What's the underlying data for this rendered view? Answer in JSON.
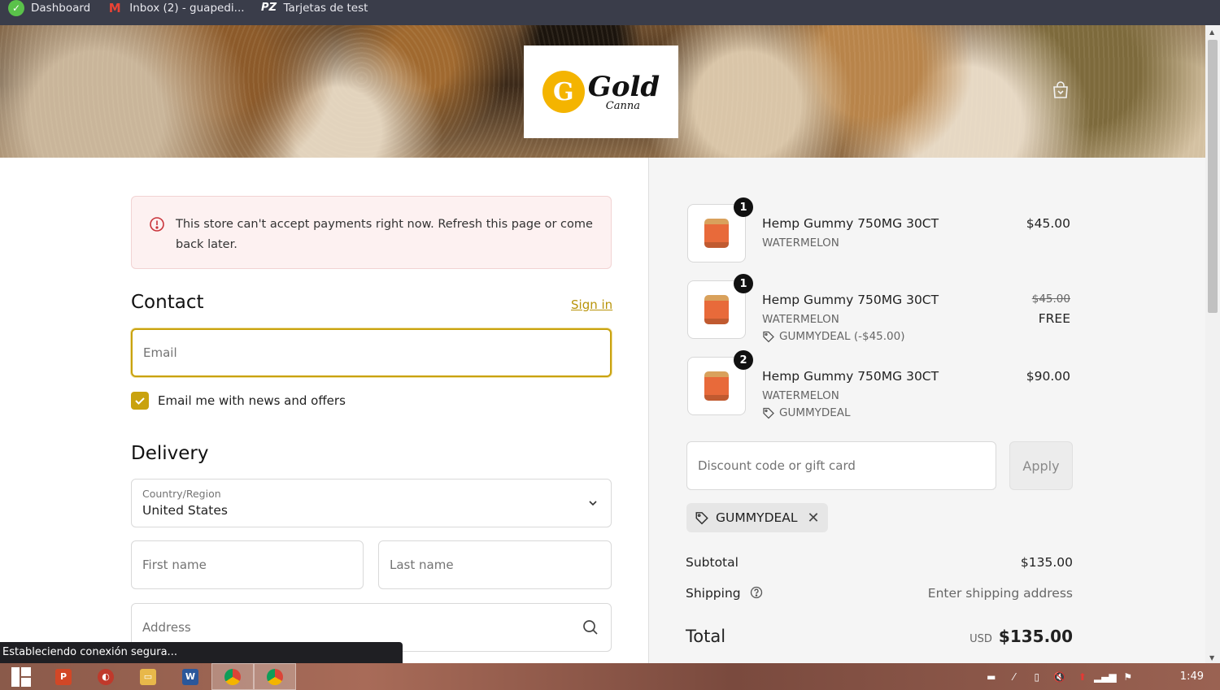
{
  "bookmarks": [
    {
      "label": "Dashboard",
      "icon": "dashboard-icon"
    },
    {
      "label": "Inbox (2) - guapedi...",
      "icon": "gmail-icon"
    },
    {
      "label": "Tarjetas de test",
      "icon": "pz-icon"
    }
  ],
  "store": {
    "logo_main": "Gold",
    "logo_sub": "Canna"
  },
  "alert": {
    "text": "This store can't accept payments right now. Refresh this page or come back later."
  },
  "contact": {
    "heading": "Contact",
    "sign_in": "Sign in",
    "email_placeholder": "Email",
    "newsletter_label": "Email me with news and offers",
    "newsletter_checked": true
  },
  "delivery": {
    "heading": "Delivery",
    "country_label": "Country/Region",
    "country_value": "United States",
    "first_name_placeholder": "First name",
    "last_name_placeholder": "Last name",
    "address_placeholder": "Address"
  },
  "status_bar": "Estableciendo conexión segura...",
  "cart": {
    "items": [
      {
        "qty": "1",
        "name": "Hemp Gummy 750MG 30CT",
        "variant": "WATERMELON",
        "price": "$45.00"
      },
      {
        "qty": "1",
        "name": "Hemp Gummy 750MG 30CT",
        "variant": "WATERMELON",
        "old_price": "$45.00",
        "price": "FREE",
        "discount": "GUMMYDEAL (-$45.00)"
      },
      {
        "qty": "2",
        "name": "Hemp Gummy 750MG 30CT",
        "variant": "WATERMELON",
        "price": "$90.00",
        "discount": "GUMMYDEAL"
      }
    ],
    "discount_placeholder": "Discount code or gift card",
    "apply_label": "Apply",
    "applied_code": "GUMMYDEAL",
    "subtotal_label": "Subtotal",
    "subtotal_value": "$135.00",
    "shipping_label": "Shipping",
    "shipping_value": "Enter shipping address",
    "total_label": "Total",
    "total_currency": "USD",
    "total_value": "$135.00"
  },
  "taskbar": {
    "time": "1:49"
  },
  "colors": {
    "accent": "#c9a20e",
    "alert_bg": "#fdf1f1",
    "summary_bg": "#f5f5f5"
  }
}
